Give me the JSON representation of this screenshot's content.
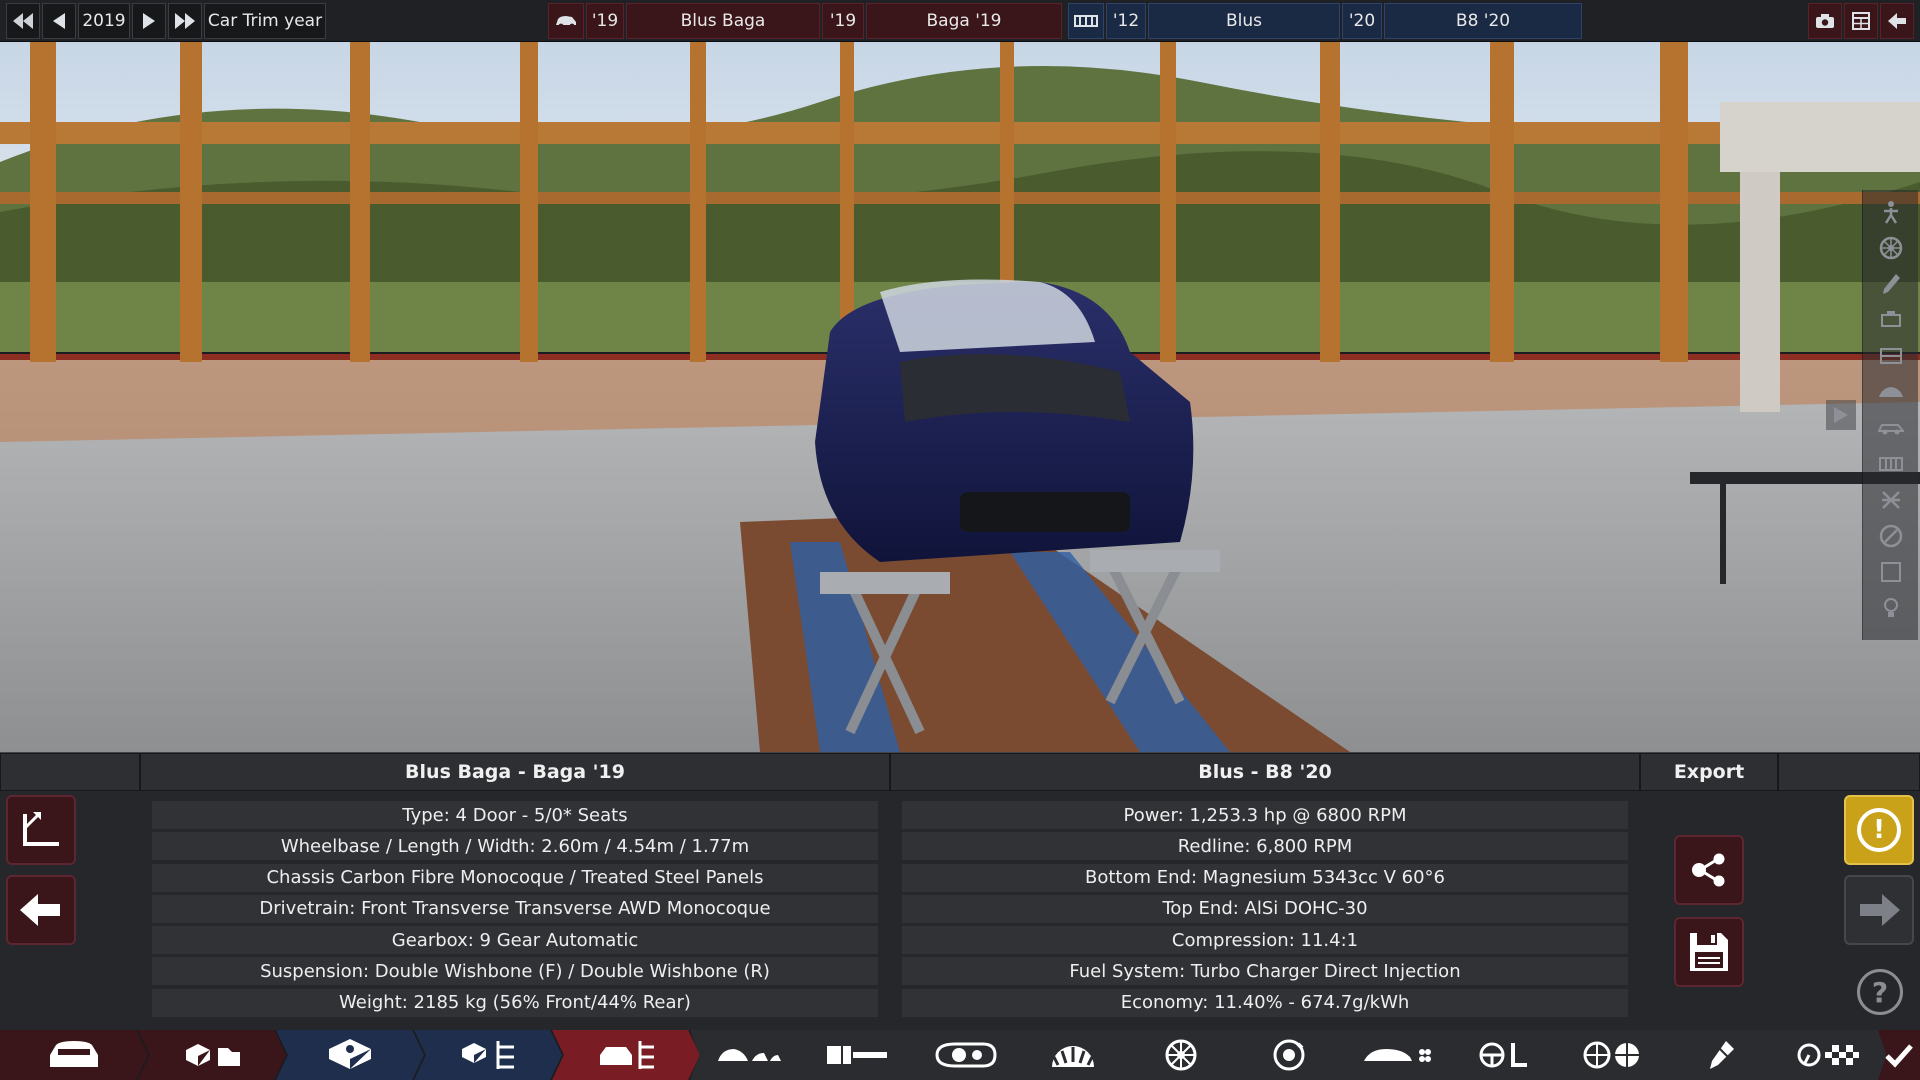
{
  "topbar": {
    "year": "2019",
    "trim_year_label": "Car Trim year",
    "model_year": "'19",
    "model_name": "Blus Baga",
    "trim_year": "'19",
    "trim_name": "Baga '19",
    "engine_family_year": "'12",
    "engine_family_name": "Blus",
    "engine_variant_year": "'20",
    "engine_variant_name": "B8 '20"
  },
  "panel": {
    "car_title": "Blus Baga - Baga '19",
    "engine_title": "Blus - B8 '20",
    "export_title": "Export",
    "car_specs": [
      "Type: 4 Door - 5/0* Seats",
      "Wheelbase / Length / Width: 2.60m / 4.54m / 1.77m",
      "Chassis Carbon Fibre Monocoque / Treated Steel Panels",
      "Drivetrain: Front Transverse Transverse AWD Monocoque",
      "Gearbox: 9 Gear Automatic",
      "Suspension: Double Wishbone (F) / Double Wishbone (R)",
      "Weight: 2185 kg (56% Front/44% Rear)"
    ],
    "engine_specs": [
      "Power: 1,253.3 hp @ 6800 RPM",
      "Redline:  6,800 RPM",
      "Bottom End: Magnesium 5343cc V 60°6",
      "Top End: AlSi DOHC-30",
      "Compression: 11.4:1",
      "Fuel System: Turbo Charger Direct Injection",
      "Economy: 11.40% - 674.7g/kWh"
    ]
  },
  "icons": {
    "help": "?",
    "warning": "!"
  },
  "colors": {
    "accent_maroon": "#3a1519",
    "accent_navy": "#1e2e4c",
    "active_tab": "#7a1c24",
    "warning_gold": "#c9a21a"
  }
}
